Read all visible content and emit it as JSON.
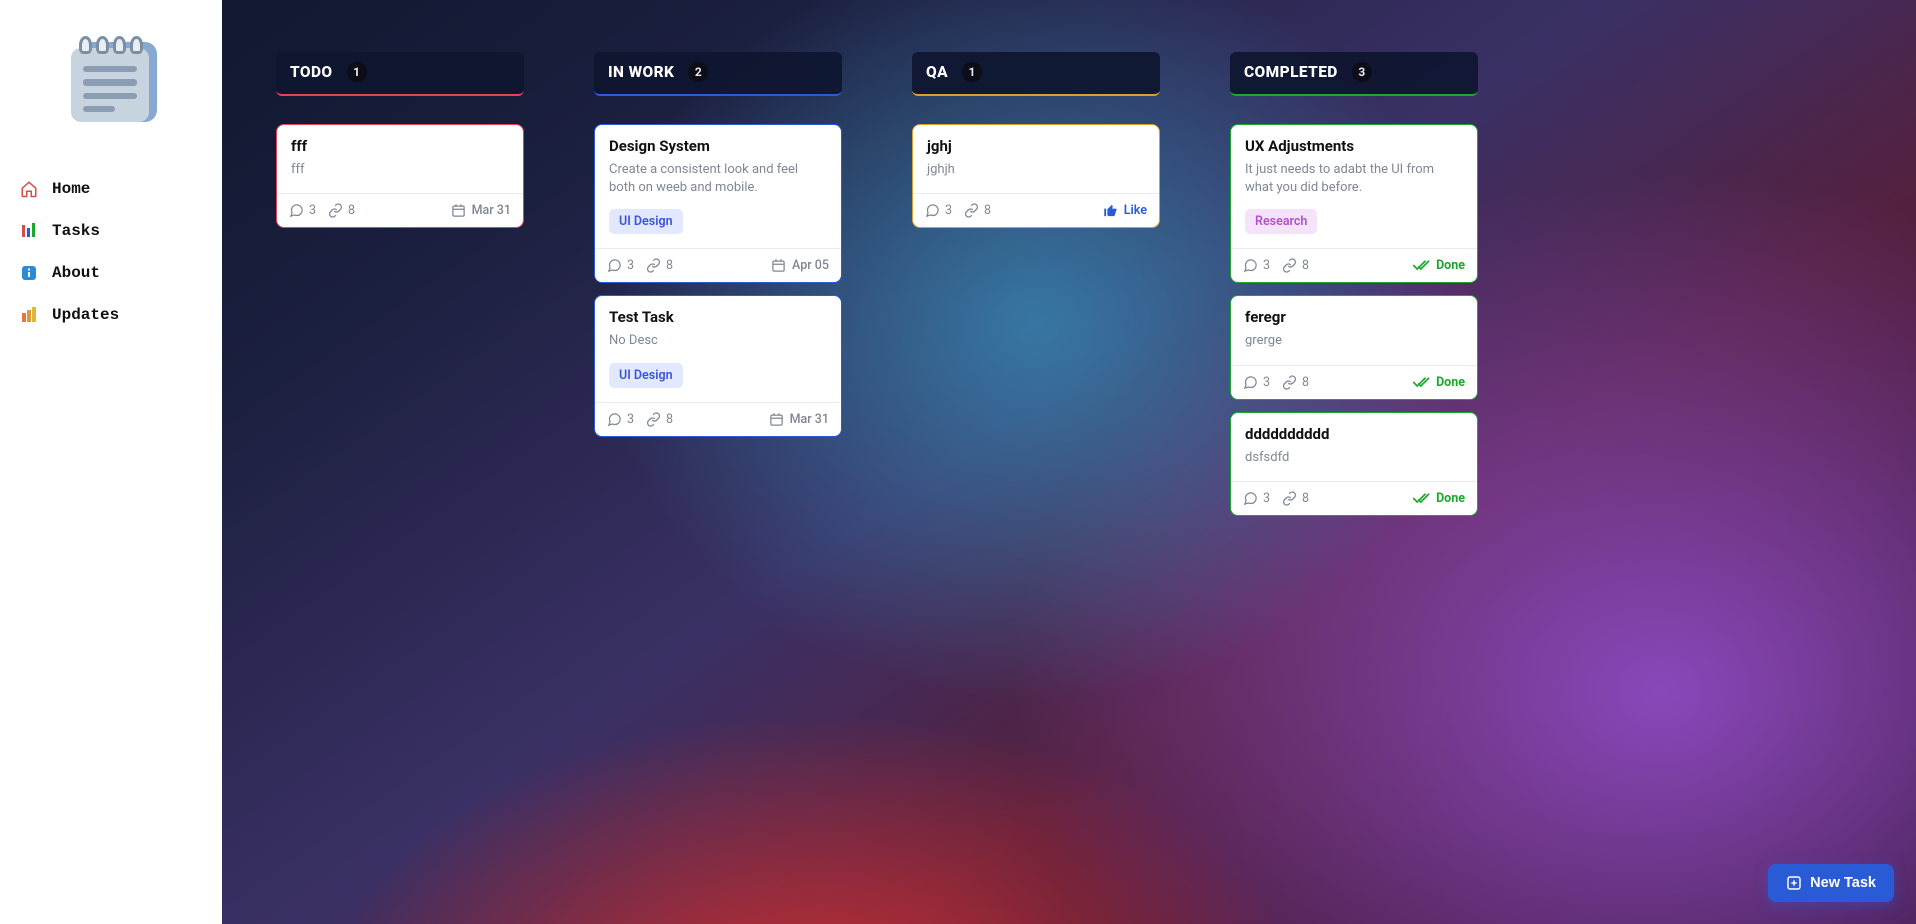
{
  "sidebar": {
    "nav": [
      {
        "label": "Home",
        "icon": "home"
      },
      {
        "label": "Tasks",
        "icon": "tasks"
      },
      {
        "label": "About",
        "icon": "info"
      },
      {
        "label": "Updates",
        "icon": "updates"
      }
    ]
  },
  "columns": [
    {
      "key": "todo",
      "title": "TODO",
      "count": "1",
      "cards": [
        {
          "title": "fff",
          "desc": "fff",
          "tag": null,
          "comments": "3",
          "links": "8",
          "right_kind": "date",
          "right_text": "Mar 31"
        }
      ]
    },
    {
      "key": "inwork",
      "title": "IN WORK",
      "count": "2",
      "cards": [
        {
          "title": "Design System",
          "desc": "Create a consistent look and feel both on weeb and mobile.",
          "tag": {
            "cls": "tag-ui",
            "text": "UI Design"
          },
          "comments": "3",
          "links": "8",
          "right_kind": "date",
          "right_text": "Apr 05"
        },
        {
          "title": "Test Task",
          "desc": "No Desc",
          "tag": {
            "cls": "tag-ui",
            "text": "UI Design"
          },
          "comments": "3",
          "links": "8",
          "right_kind": "date",
          "right_text": "Mar 31"
        }
      ]
    },
    {
      "key": "qa",
      "title": "QA",
      "count": "1",
      "cards": [
        {
          "title": "jghj",
          "desc": "jghjh",
          "tag": null,
          "comments": "3",
          "links": "8",
          "right_kind": "like",
          "right_text": "Like"
        }
      ]
    },
    {
      "key": "completed",
      "title": "COMPLETED",
      "count": "3",
      "cards": [
        {
          "title": "UX Adjustments",
          "desc": "It just needs to adabt the UI from what you did before.",
          "tag": {
            "cls": "tag-research",
            "text": "Research"
          },
          "comments": "3",
          "links": "8",
          "right_kind": "done",
          "right_text": "Done"
        },
        {
          "title": "feregr",
          "desc": "grerge",
          "tag": null,
          "comments": "3",
          "links": "8",
          "right_kind": "done",
          "right_text": "Done"
        },
        {
          "title": "dddddddddd",
          "desc": "dsfsdfd",
          "tag": null,
          "comments": "3",
          "links": "8",
          "right_kind": "done",
          "right_text": "Done"
        }
      ]
    }
  ],
  "fab": {
    "label": "New Task"
  }
}
